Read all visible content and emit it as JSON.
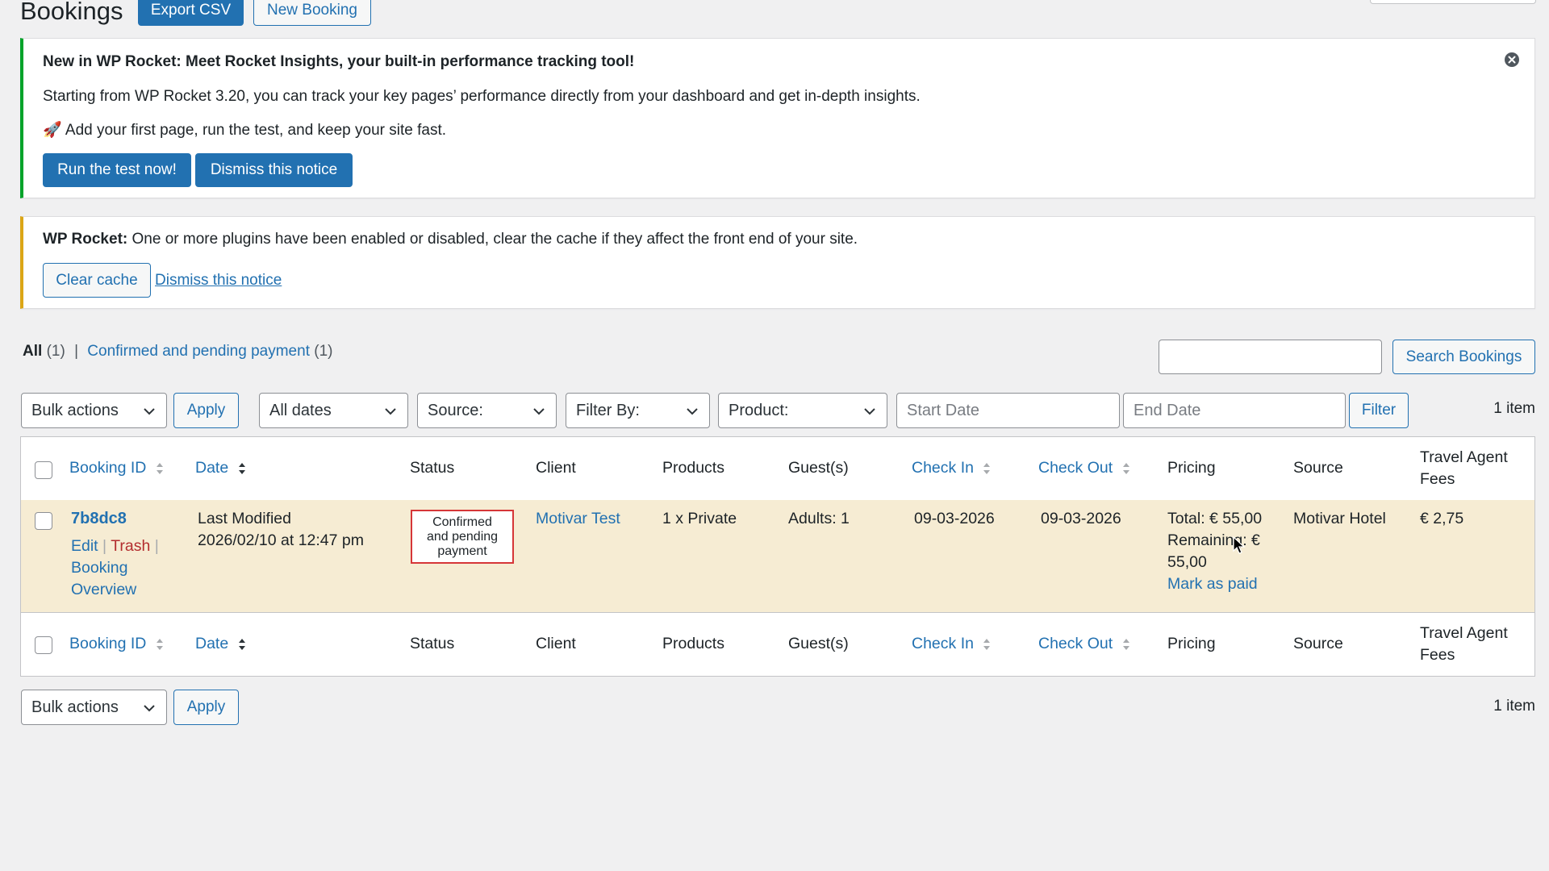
{
  "page": {
    "title": "Bookings",
    "export_label": "Export CSV",
    "new_label": "New Booking"
  },
  "notice_rocket": {
    "heading": "New in WP Rocket: Meet Rocket Insights, your built-in performance tracking tool!",
    "body": "Starting from WP Rocket 3.20, you can track your key pages’ performance directly from your dashboard and get in-depth insights.",
    "tip_emoji": "🚀",
    "tip": "Add your first page, run the test, and keep your site fast.",
    "run_label": "Run the test now!",
    "dismiss_label": "Dismiss this notice"
  },
  "notice_cache": {
    "strong": "WP Rocket:",
    "message": " One or more plugins have been enabled or disabled, clear the cache if they affect the front end of your site.",
    "clear_label": "Clear cache",
    "dismiss_label": "Dismiss this notice"
  },
  "views": {
    "all_label": "All",
    "all_count": "(1)",
    "separator": "|",
    "confirmed_label": "Confirmed and pending payment",
    "confirmed_count": "(1)"
  },
  "search": {
    "value": "",
    "button_label": "Search Bookings"
  },
  "filters": {
    "bulk_actions": "Bulk actions",
    "apply": "Apply",
    "dates": "All dates",
    "source": "Source:",
    "filter_by": "Filter By:",
    "product": "Product:",
    "start_date_placeholder": "Start Date",
    "end_date_placeholder": "End Date",
    "filter_button": "Filter",
    "item_count": "1 item"
  },
  "table": {
    "columns": {
      "booking_id": "Booking ID",
      "date": "Date",
      "status": "Status",
      "client": "Client",
      "products": "Products",
      "guests": "Guest(s)",
      "check_in": "Check In",
      "check_out": "Check Out",
      "pricing": "Pricing",
      "source": "Source",
      "fees_line1": "Travel Agent",
      "fees_line2": "Fees"
    },
    "row": {
      "booking_id": "7b8dc8",
      "edit": "Edit",
      "trash": "Trash",
      "sep": "|",
      "overview_line1": "Booking",
      "overview_line2": "Overview",
      "date_line1": "Last Modified",
      "date_line2": "2026/02/10 at 12:47 pm",
      "status_line1": "Confirmed",
      "status_line2": "and pending",
      "status_line3": "payment",
      "client": "Motivar Test",
      "products": "1 x Private",
      "guests": "Adults: 1",
      "check_in": "09-03-2026",
      "check_out": "09-03-2026",
      "total": "Total: € 55,00",
      "remaining_line1": "Remaining: €",
      "remaining_line2": "55,00",
      "mark_paid": "Mark as paid",
      "source": "Motivar Hotel",
      "fees": "€ 2,75"
    }
  },
  "bottom": {
    "bulk_actions": "Bulk actions",
    "apply": "Apply",
    "item_count": "1 item"
  },
  "colors": {
    "accent": "#2271b1",
    "notice_green": "#00a32a",
    "notice_yellow": "#dba617",
    "row_highlight": "#f6ecd3",
    "status_border": "#d63638",
    "trash_red": "#b32d2e"
  }
}
